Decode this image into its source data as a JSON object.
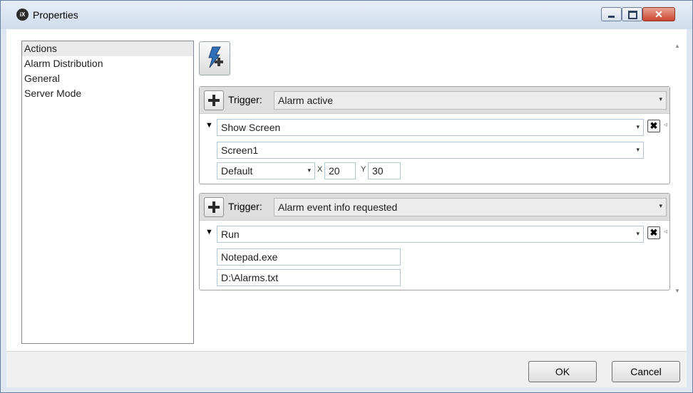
{
  "window": {
    "title": "Properties",
    "app_icon_text": "iX",
    "close_glyph": "✕"
  },
  "sidebar": {
    "items": [
      {
        "label": "Actions",
        "selected": true
      },
      {
        "label": "Alarm Distribution",
        "selected": false
      },
      {
        "label": "General",
        "selected": false
      },
      {
        "label": "Server Mode",
        "selected": false
      }
    ]
  },
  "toolbar": {
    "add_action_icon": "lightning-plus-icon"
  },
  "actions": [
    {
      "trigger_label": "Trigger:",
      "trigger_value": "Alarm active",
      "action": "Show Screen",
      "screen": "Screen1",
      "position": "Default",
      "x_label": "X",
      "x_value": "20",
      "y_label": "Y",
      "y_value": "30"
    },
    {
      "trigger_label": "Trigger:",
      "trigger_value": "Alarm event info requested",
      "action": "Run",
      "program": "Notepad.exe",
      "argument": "D:\\Alarms.txt"
    }
  ],
  "icons": {
    "delete": "✖",
    "dropdown": "▾",
    "expander": "▼",
    "grip": "◃",
    "scroll_up": "▲",
    "scroll_down": "▼"
  },
  "footer": {
    "ok_label": "OK",
    "cancel_label": "Cancel"
  },
  "colors": {
    "close_button": "#c9452e",
    "trigger_row": "#dedede",
    "title_bar": "#dae4f0"
  }
}
